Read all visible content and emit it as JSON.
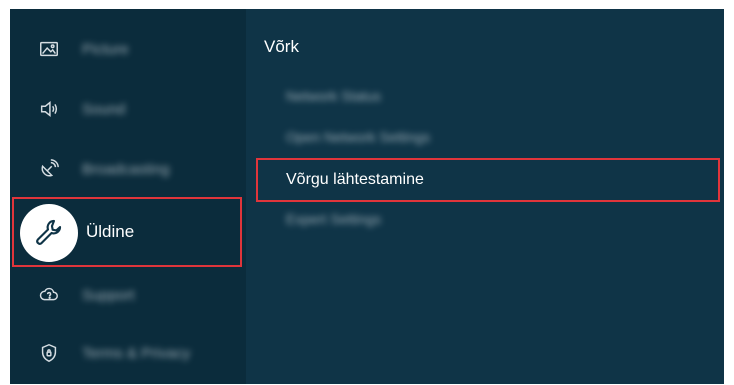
{
  "sidebar": {
    "items": [
      {
        "label": "Picture",
        "icon": "picture-icon"
      },
      {
        "label": "Sound",
        "icon": "sound-icon"
      },
      {
        "label": "Broadcasting",
        "icon": "broadcasting-icon"
      },
      {
        "label": "Üldine",
        "icon": "wrench-icon",
        "selected": true
      },
      {
        "label": "Support",
        "icon": "support-cloud-icon"
      },
      {
        "label": "Terms & Privacy",
        "icon": "shield-icon"
      }
    ]
  },
  "panel": {
    "title": "Võrk",
    "items": [
      {
        "label": "Network Status"
      },
      {
        "label": "Open Network Settings"
      },
      {
        "label": "Võrgu lähtestamine",
        "selected": true
      },
      {
        "label": "Expert Settings"
      }
    ]
  },
  "colors": {
    "background": "#0f3447",
    "sidebar": "#0b2c3c",
    "highlight_border": "#e0353b",
    "text": "#ffffff"
  }
}
